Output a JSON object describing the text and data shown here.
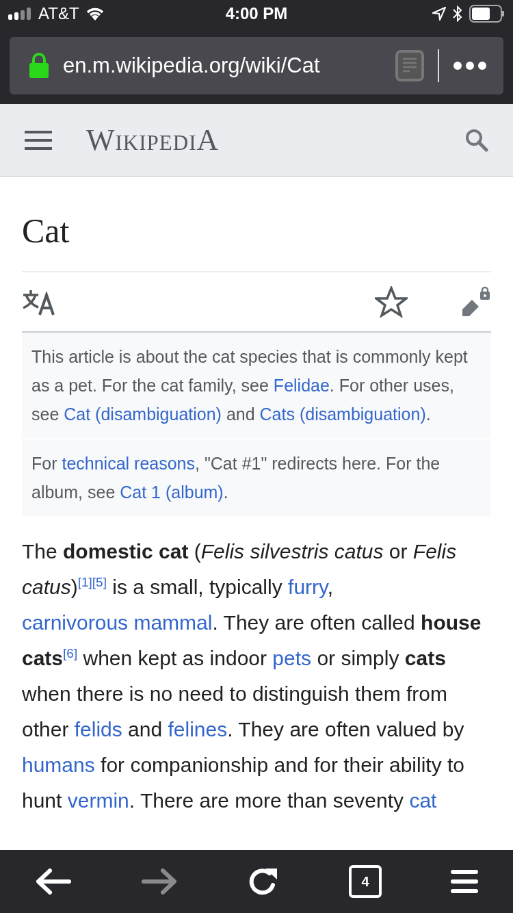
{
  "status_bar": {
    "carrier": "AT&T",
    "time": "4:00 PM"
  },
  "address_bar": {
    "url": "en.m.wikipedia.org/wiki/Cat",
    "secure": true
  },
  "site_header": {
    "logo": "WikipediA"
  },
  "article": {
    "title": "Cat",
    "hatnotes": [
      [
        {
          "kind": "text",
          "text": "This article is about the cat species that is commonly kept as a pet. For the cat family, see "
        },
        {
          "kind": "link",
          "text": "Felidae"
        },
        {
          "kind": "text",
          "text": ". For other uses, see "
        },
        {
          "kind": "link",
          "text": "Cat (disambiguation)"
        },
        {
          "kind": "text",
          "text": " and "
        },
        {
          "kind": "link",
          "text": "Cats (disambiguation)"
        },
        {
          "kind": "text",
          "text": "."
        }
      ],
      [
        {
          "kind": "text",
          "text": "For "
        },
        {
          "kind": "link",
          "text": "technical reasons"
        },
        {
          "kind": "text",
          "text": ", \"Cat #1\" redirects here. For the album, see "
        },
        {
          "kind": "link",
          "text": "Cat 1 (album)"
        },
        {
          "kind": "text",
          "text": "."
        }
      ]
    ],
    "paragraph": [
      {
        "kind": "text",
        "text": "The **domestic cat** (*Felis silvestris catus* or *Felis catus*)"
      },
      {
        "kind": "ref",
        "text": "[1]"
      },
      {
        "kind": "ref",
        "text": "[5]"
      },
      {
        "kind": "text",
        "text": " is a small, typically "
      },
      {
        "kind": "link",
        "text": "furry"
      },
      {
        "kind": "text",
        "text": ", "
      },
      {
        "kind": "link",
        "text": "carnivorous mammal"
      },
      {
        "kind": "text",
        "text": ". They are often called **house cats**"
      },
      {
        "kind": "ref",
        "text": "[6]"
      },
      {
        "kind": "text",
        "text": " when kept as indoor "
      },
      {
        "kind": "link",
        "text": "pets"
      },
      {
        "kind": "text",
        "text": " or simply **cats** when there is no need to distinguish them from other "
      },
      {
        "kind": "link",
        "text": "felids"
      },
      {
        "kind": "text",
        "text": " and "
      },
      {
        "kind": "link",
        "text": "felines"
      },
      {
        "kind": "text",
        "text": ". They are often valued by "
      },
      {
        "kind": "link",
        "text": "humans"
      },
      {
        "kind": "text",
        "text": " for companionship and for their ability to hunt "
      },
      {
        "kind": "link",
        "text": "vermin"
      },
      {
        "kind": "text",
        "text": ". There are more than seventy "
      },
      {
        "kind": "link",
        "text": "cat"
      }
    ]
  },
  "toolbar": {
    "tab_count": "4",
    "forward_disabled": true
  }
}
